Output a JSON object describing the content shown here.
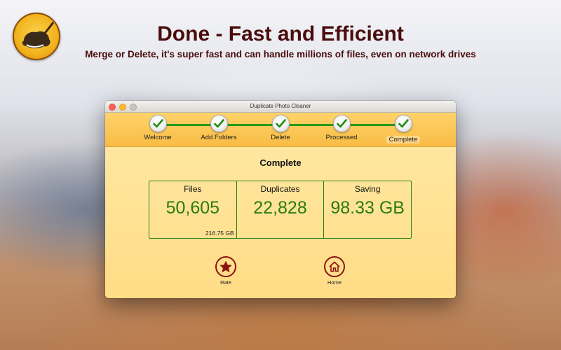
{
  "header": {
    "title": "Done - Fast and Efficient",
    "subtitle": "Merge or Delete, it's super fast and can handle millions of files, even on network drives"
  },
  "window": {
    "title": "Duplicate Photo Cleaner"
  },
  "steps": [
    {
      "label": "Welcome",
      "done": true
    },
    {
      "label": "Add Folders",
      "done": true
    },
    {
      "label": "Delete",
      "done": true
    },
    {
      "label": "Processed",
      "done": true
    },
    {
      "label": "Complete",
      "done": true,
      "active": true
    }
  ],
  "result": {
    "title": "Complete",
    "stats": [
      {
        "label": "Files",
        "value": "50,605",
        "sub": "216.75 GB"
      },
      {
        "label": "Duplicates",
        "value": "22,828"
      },
      {
        "label": "Saving",
        "value": "98.33 GB"
      }
    ]
  },
  "actions": [
    {
      "label": "Rate",
      "icon": "star-icon"
    },
    {
      "label": "Home",
      "icon": "home-icon"
    }
  ],
  "colors": {
    "accent_green": "#2c7a12",
    "heading": "#4a0c0c",
    "icon_red": "#8b1412"
  }
}
